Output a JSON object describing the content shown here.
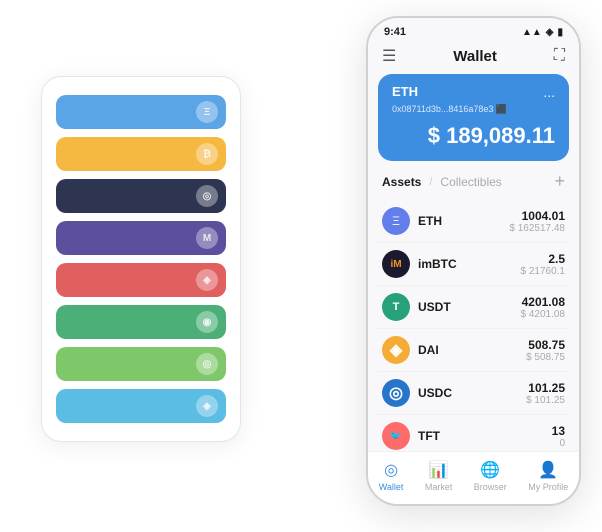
{
  "scene": {
    "cardStack": {
      "cards": [
        {
          "color": "card-blue",
          "symbol": "Ξ"
        },
        {
          "color": "card-yellow",
          "symbol": "₿"
        },
        {
          "color": "card-dark",
          "symbol": "◎"
        },
        {
          "color": "card-purple",
          "symbol": "M"
        },
        {
          "color": "card-red",
          "symbol": "◈"
        },
        {
          "color": "card-green",
          "symbol": "◉"
        },
        {
          "color": "card-light-green",
          "symbol": "◎"
        },
        {
          "color": "card-light-blue",
          "symbol": "◈"
        }
      ]
    },
    "phone": {
      "statusBar": {
        "time": "9:41",
        "icons": "▲▲ ◼"
      },
      "header": {
        "menuIcon": "☰",
        "title": "Wallet",
        "expandIcon": "⛶"
      },
      "ethCard": {
        "label": "ETH",
        "address": "0x08711d3b...8416a78e3 ⬛",
        "amount": "$ 189,089.11",
        "menuDots": "..."
      },
      "assetSection": {
        "activeTab": "Assets",
        "separator": "/",
        "inactiveTab": "Collectibles",
        "addIcon": "+"
      },
      "assets": [
        {
          "name": "ETH",
          "iconBg": "eth-icon",
          "iconText": "Ξ",
          "amountPrimary": "1004.01",
          "amountSecondary": "$ 162517.48"
        },
        {
          "name": "imBTC",
          "iconBg": "imbtc-icon",
          "iconText": "iM",
          "amountPrimary": "2.5",
          "amountSecondary": "$ 21760.1"
        },
        {
          "name": "USDT",
          "iconBg": "usdt-icon",
          "iconText": "T",
          "amountPrimary": "4201.08",
          "amountSecondary": "$ 4201.08"
        },
        {
          "name": "DAI",
          "iconBg": "dai-icon",
          "iconText": "◈",
          "amountPrimary": "508.75",
          "amountSecondary": "$ 508.75"
        },
        {
          "name": "USDC",
          "iconBg": "usdc-icon",
          "iconText": "◎",
          "amountPrimary": "101.25",
          "amountSecondary": "$ 101.25"
        },
        {
          "name": "TFT",
          "iconBg": "tft-icon",
          "iconText": "🐦",
          "amountPrimary": "13",
          "amountSecondary": "0"
        }
      ],
      "bottomNav": [
        {
          "id": "wallet",
          "icon": "◎",
          "label": "Wallet",
          "active": true
        },
        {
          "id": "market",
          "icon": "📈",
          "label": "Market",
          "active": false
        },
        {
          "id": "browser",
          "icon": "🌐",
          "label": "Browser",
          "active": false
        },
        {
          "id": "profile",
          "icon": "👤",
          "label": "My Profile",
          "active": false
        }
      ]
    }
  }
}
